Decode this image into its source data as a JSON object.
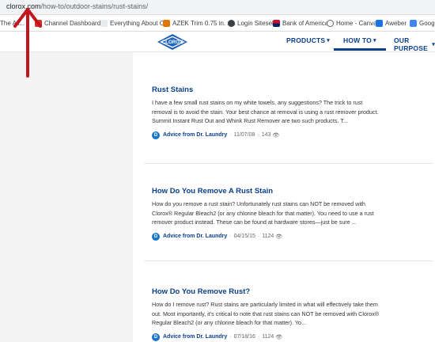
{
  "browser": {
    "url_host": "clorox.com",
    "url_path": "/how-to/outdoor-stains/rust-stains/"
  },
  "bookmarks": [
    {
      "label": "The All...",
      "icon": "generic-bookmark-icon",
      "color": "#5a5a5a"
    },
    {
      "label": "Channel Dashboard...",
      "icon": "dashboard-bookmark-icon",
      "color": "#d93025"
    },
    {
      "label": "Everything About C...",
      "icon": "page-bookmark-icon",
      "color": "#9aa0a6"
    },
    {
      "label": "AZEK Trim 0.75 in. x...",
      "icon": "azek-bookmark-icon",
      "color": "#e37400"
    },
    {
      "label": "Login Sitesell",
      "icon": "sitesell-bookmark-icon",
      "color": "#3c4043"
    },
    {
      "label": "Bank of America",
      "icon": "bofa-bookmark-icon",
      "color": "#c5112e"
    },
    {
      "label": "Home - Canva",
      "icon": "globe-bookmark-icon",
      "color": "#5f6368"
    },
    {
      "label": "Aweber",
      "icon": "aweber-bookmark-icon",
      "color": "#1a73e8"
    },
    {
      "label": "Google",
      "icon": "google-bookmark-icon",
      "color": "#4285f4"
    }
  ],
  "header": {
    "logo_text": "CLOROX",
    "nav": [
      {
        "label": "PRODUCTS",
        "active": false
      },
      {
        "label": "HOW TO",
        "active": true
      },
      {
        "label": "OUR PURPOSE",
        "active": false
      }
    ]
  },
  "articles": [
    {
      "title": "Rust Stains",
      "body": "I have a few small rust stains on my white towels, any suggestions? The trick to rust removal is to avoid the stain. Your best chance at removal is using a rust remover product. Summit Instant Rust Out and Whink Rust Remover are two such products. T...",
      "author": "Advice from Dr. Laundry",
      "date": "11/07/08",
      "views": "143"
    },
    {
      "title": "How Do You Remove A Rust Stain",
      "body": "How do you remove a rust stain? Unfortunately rust stains can NOT be removed with Clorox® Regular Bleach2 (or any chlorine bleach for that matter).  You need to use a rust remover product instead.  These can be found at hardware stores—just be sure ...",
      "author": "Advice from Dr. Laundry",
      "date": "04/15/15",
      "views": "1124"
    },
    {
      "title": "How Do You Remove Rust?",
      "body": "How do I remove rust? Rust stains are particularly limited in what will effectively take them out.  Most importantly, it's critical to note that rust stains can NOT be removed with Clorox® Regular Bleach2 (or any chlorine bleach for that matter).  Yo...",
      "author": "Advice from Dr. Laundry",
      "date": "07/18/16",
      "views": "1124"
    }
  ],
  "colors": {
    "brand_blue": "#0b3f8a",
    "annotation_red": "#c0161c",
    "sidebar_gray": "#f4f4f4"
  }
}
